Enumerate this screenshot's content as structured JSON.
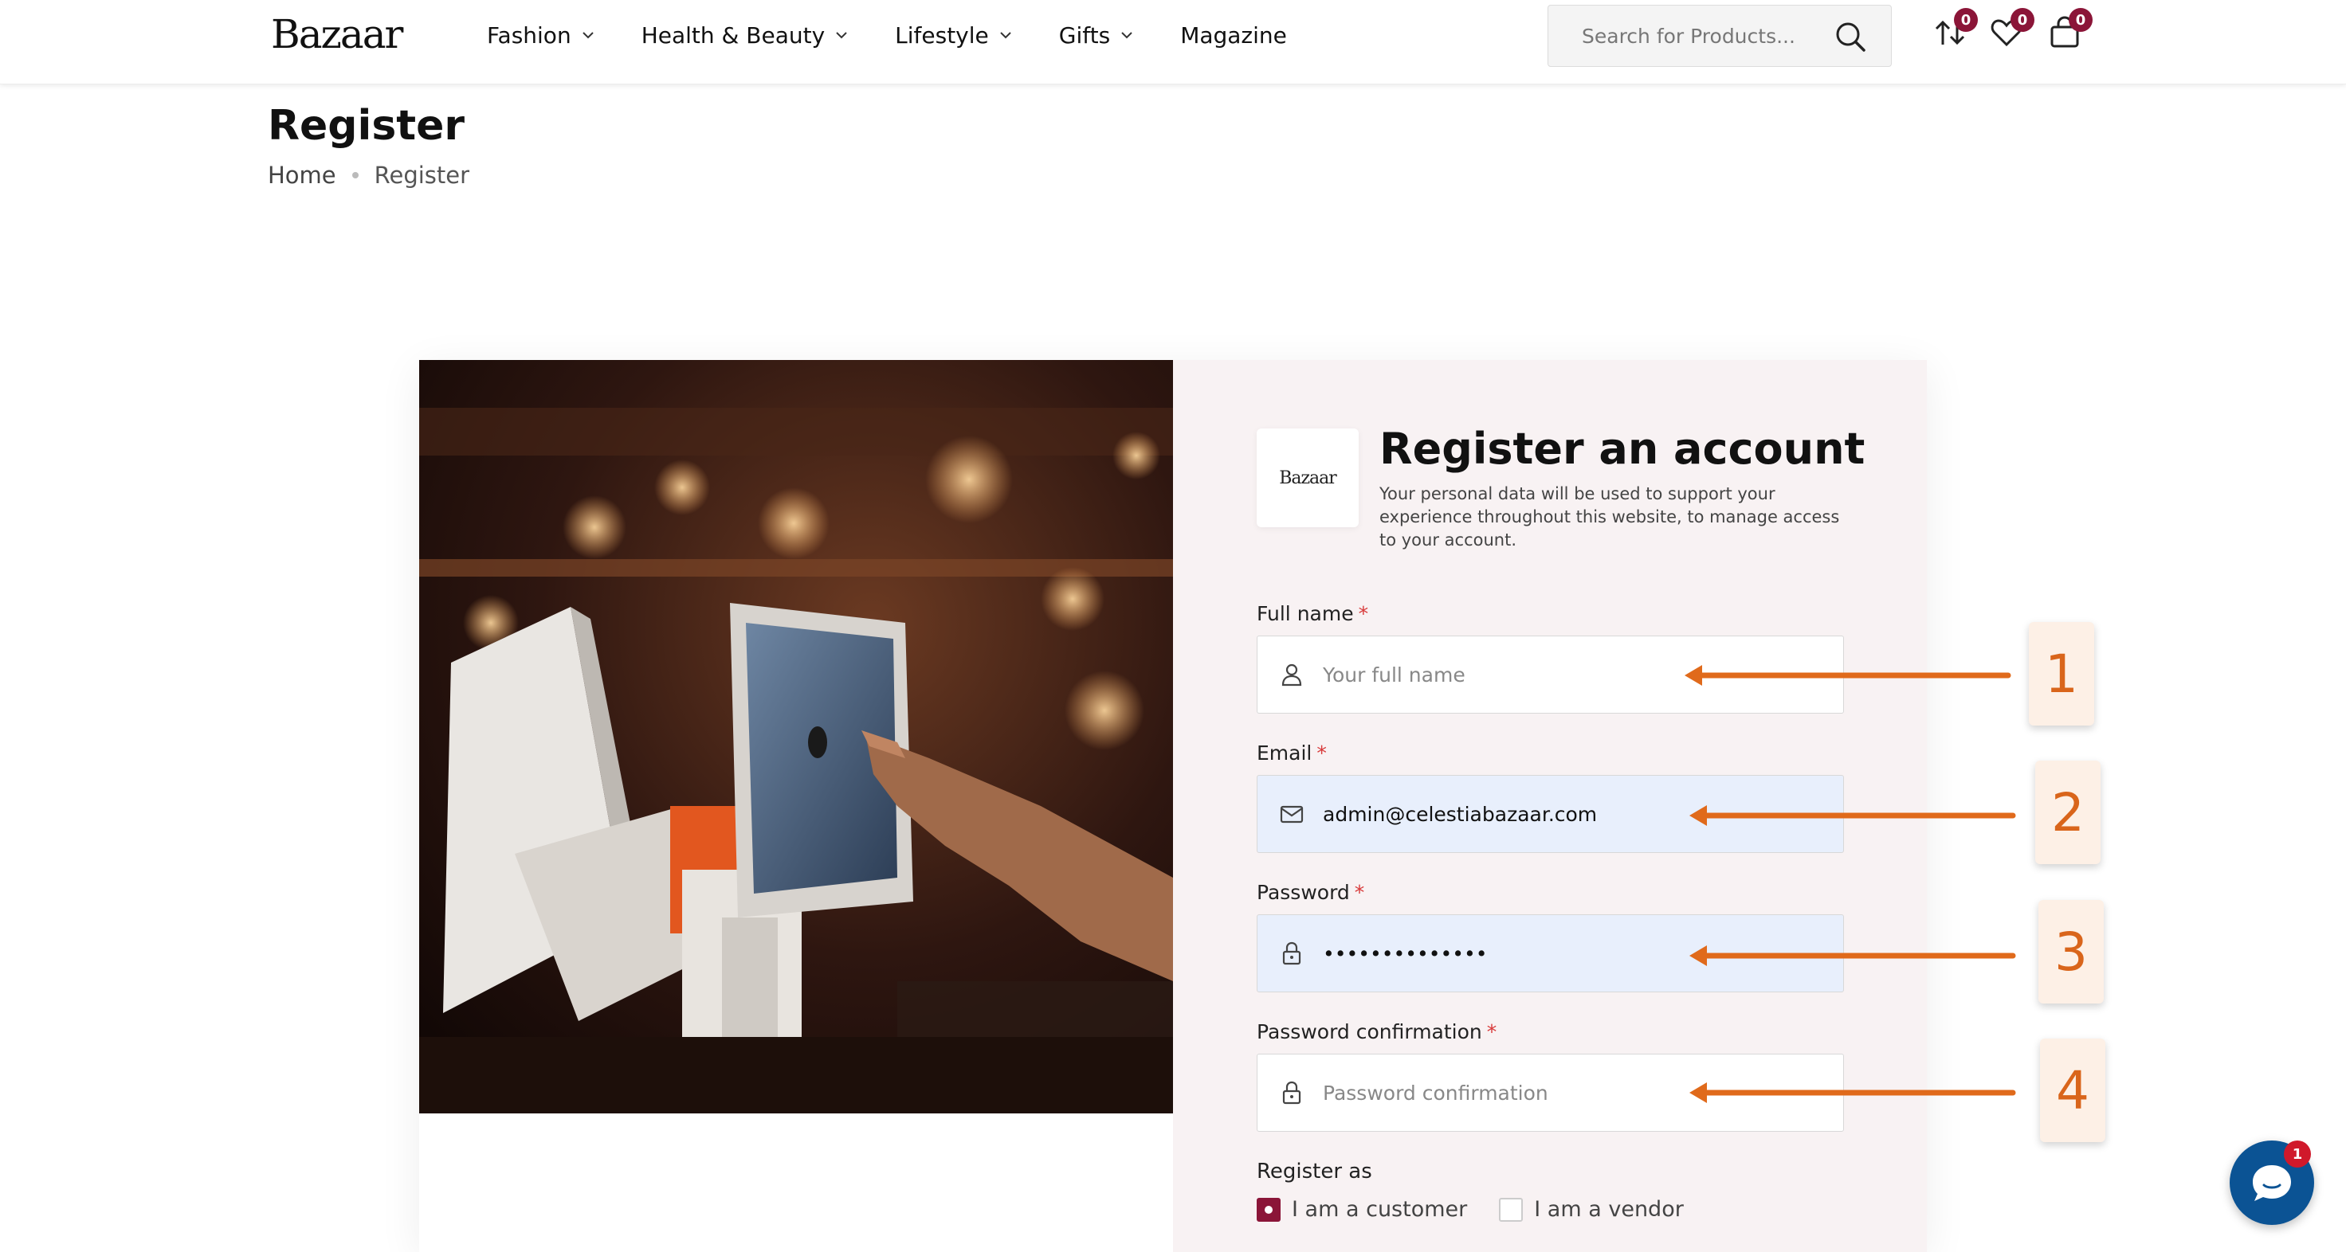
{
  "header": {
    "logo": "Bazaar",
    "nav": [
      {
        "label": "Fashion",
        "has_dropdown": true
      },
      {
        "label": "Health & Beauty",
        "has_dropdown": true
      },
      {
        "label": "Lifestyle",
        "has_dropdown": true
      },
      {
        "label": "Gifts",
        "has_dropdown": true
      },
      {
        "label": "Magazine",
        "has_dropdown": false
      }
    ],
    "search_placeholder": "Search for Products...",
    "icons": {
      "compare": {
        "icon": "compare-arrows-icon",
        "count": "0"
      },
      "wishlist": {
        "icon": "heart-icon",
        "count": "0"
      },
      "cart": {
        "icon": "shopping-bag-icon",
        "count": "0"
      }
    }
  },
  "page": {
    "title": "Register",
    "breadcrumb": {
      "home": "Home",
      "current": "Register"
    }
  },
  "form": {
    "logo_text": "Bazaar",
    "title": "Register an account",
    "description": "Your personal data will be used to support your experience throughout this website, to manage access to your account.",
    "fields": {
      "full_name": {
        "label": "Full name",
        "required": "*",
        "placeholder": "Your full name",
        "value": "",
        "icon": "user-icon"
      },
      "email": {
        "label": "Email",
        "required": "*",
        "placeholder": "",
        "value": "admin@celestiabazaar.com",
        "icon": "mail-icon"
      },
      "password": {
        "label": "Password",
        "required": "*",
        "placeholder": "",
        "value": "••••••••••••••",
        "icon": "lock-icon"
      },
      "password_confirmation": {
        "label": "Password confirmation",
        "required": "*",
        "placeholder": "Password confirmation",
        "value": "",
        "icon": "lock-icon"
      }
    },
    "register_as": {
      "label": "Register as",
      "options": [
        {
          "label": "I am a customer",
          "checked": true
        },
        {
          "label": "I am a vendor",
          "checked": false
        }
      ]
    }
  },
  "annotations": [
    "1",
    "2",
    "3",
    "4"
  ],
  "chat": {
    "badge": "1",
    "icon": "chat-bubble-icon"
  },
  "colors": {
    "brand": "#8b1538",
    "annotation_orange": "#d9651b",
    "form_panel_bg": "#f8f2f3",
    "filled_field_bg": "#e8effc",
    "chat_blue": "#0b5394"
  }
}
